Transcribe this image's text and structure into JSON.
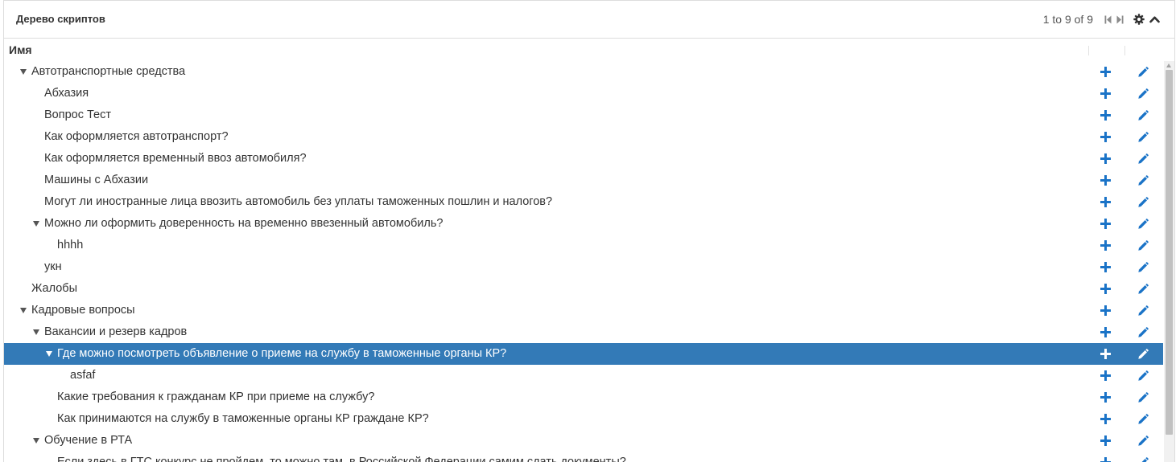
{
  "panel": {
    "title": "Дерево скриптов",
    "pager_text": "1 to 9 of 9"
  },
  "grid": {
    "column_name": "Имя"
  },
  "colors": {
    "accent": "#1a73c7",
    "selected_bg": "#337ab7"
  },
  "rows": [
    {
      "label": "Автотранспортные средства",
      "level": 0,
      "expanded": true,
      "selected": false
    },
    {
      "label": "Абхазия",
      "level": 1,
      "expanded": false,
      "selected": false
    },
    {
      "label": "Вопрос Тест",
      "level": 1,
      "expanded": false,
      "selected": false
    },
    {
      "label": "Как оформляется автотранспорт?",
      "level": 1,
      "expanded": false,
      "selected": false
    },
    {
      "label": "Как оформляется временный ввоз автомобиля?",
      "level": 1,
      "expanded": false,
      "selected": false
    },
    {
      "label": "Машины с Абхазии",
      "level": 1,
      "expanded": false,
      "selected": false
    },
    {
      "label": "Могут ли иностранные лица ввозить автомобиль без уплаты таможенных пошлин и налогов?",
      "level": 1,
      "expanded": false,
      "selected": false
    },
    {
      "label": "Можно ли оформить доверенность на временно ввезенный автомобиль?",
      "level": 1,
      "expanded": true,
      "selected": false
    },
    {
      "label": "hhhh",
      "level": 2,
      "expanded": false,
      "selected": false
    },
    {
      "label": "укн",
      "level": 1,
      "expanded": false,
      "selected": false
    },
    {
      "label": "Жалобы",
      "level": 0,
      "expanded": false,
      "selected": false
    },
    {
      "label": "Кадровые вопросы",
      "level": 0,
      "expanded": true,
      "selected": false
    },
    {
      "label": "Вакансии и резерв кадров",
      "level": 1,
      "expanded": true,
      "selected": false
    },
    {
      "label": "Где можно посмотреть объявление о приеме на службу в таможенные органы КР?",
      "level": 2,
      "expanded": true,
      "selected": true
    },
    {
      "label": "asfaf",
      "level": 3,
      "expanded": false,
      "selected": false
    },
    {
      "label": "Какие требования к гражданам КР при приеме на службу?",
      "level": 2,
      "expanded": false,
      "selected": false
    },
    {
      "label": "Как принимаются на службу в таможенные органы КР граждане КР?",
      "level": 2,
      "expanded": false,
      "selected": false
    },
    {
      "label": "Обучение в РТА",
      "level": 1,
      "expanded": true,
      "selected": false
    },
    {
      "label": "Если здесь в ГТС конкурс не пройдем, то можно там, в Российской Федерации самим сдать документы?",
      "level": 2,
      "expanded": false,
      "selected": false
    }
  ],
  "icons": {
    "add": "plus-icon",
    "edit": "pencil-icon",
    "expander": "caret-down-icon",
    "first_page": "first-page-icon",
    "last_page": "last-page-icon",
    "settings": "gear-icon",
    "collapse": "chevron-up-icon"
  }
}
